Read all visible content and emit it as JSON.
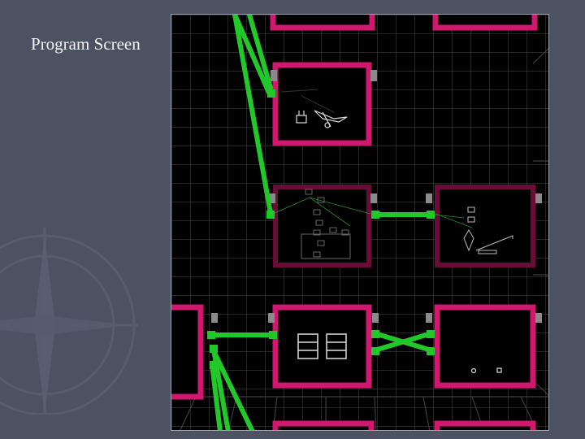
{
  "slide": {
    "title": "Program Screen"
  },
  "screen": {
    "description_colors": {
      "grid": "#3a3a3a",
      "frame": "#d0186e",
      "wire": "#22c82a",
      "port": "#8a8a8a"
    }
  }
}
